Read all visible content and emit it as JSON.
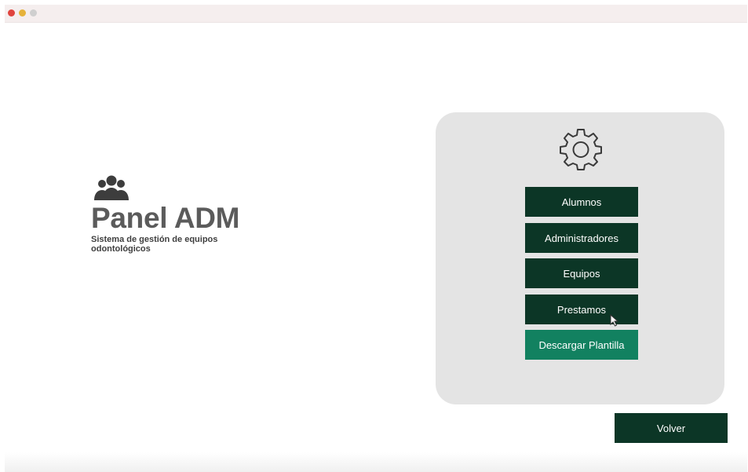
{
  "window": {
    "traffic_lights": [
      "close",
      "minimize",
      "zoom"
    ]
  },
  "brand": {
    "icon": "users-group-icon",
    "title": "Panel ADM",
    "subtitle": "Sistema de gestión de equipos odontológicos"
  },
  "panel": {
    "icon": "gear-icon",
    "buttons": [
      {
        "label": "Alumnos"
      },
      {
        "label": "Administradores"
      },
      {
        "label": "Equipos"
      },
      {
        "label": "Prestamos"
      },
      {
        "label": "Descargar Plantilla"
      }
    ]
  },
  "footer": {
    "back_label": "Volver"
  },
  "colors": {
    "primary": "#0c3626",
    "accent": "#128160",
    "panel_bg": "#e4e4e4",
    "title_text": "#5b5b5b"
  }
}
